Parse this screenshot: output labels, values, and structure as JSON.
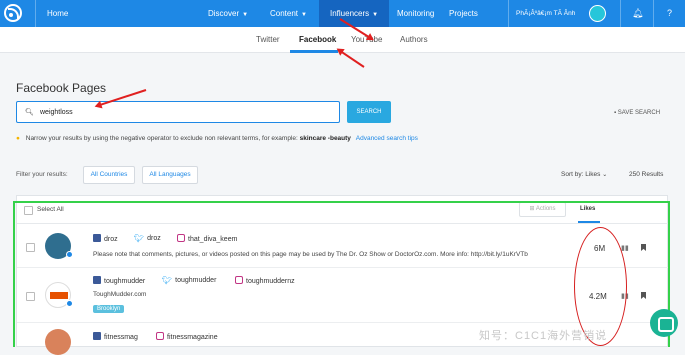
{
  "topbar": {
    "nav": [
      "Home",
      "Discover",
      "Content",
      "Influencers",
      "Monitoring",
      "Projects"
    ],
    "user": "PhÃ¡Âºâ€¡m TÃ Â­nh"
  },
  "subnav": {
    "tabs": [
      "Twitter",
      "Facebook",
      "YouTube",
      "Authors"
    ],
    "active": "Facebook"
  },
  "page": {
    "title": "Facebook Pages",
    "search_value": "weightloss",
    "search_button": "SEARCH",
    "save_search": "SAVE SEARCH",
    "hint_text": "Narrow your results by using the negative operator to exclude non relevant terms, for example:",
    "hint_example": "skincare -beauty",
    "hint_link": "Advanced search tips"
  },
  "filters": {
    "label": "Filter your results:",
    "countries": "All Countries",
    "languages": "All Languages",
    "sort": "Sort by: Likes",
    "results": "250 Results"
  },
  "table": {
    "select_all": "Select All",
    "actions": "Actions",
    "likes_header": "Likes",
    "rows": [
      {
        "facebook": "droz",
        "twitter": "droz",
        "instagram": "that_diva_keem",
        "description": "Please note that comments, pictures, or videos posted on this page may be used by The Dr. Oz Show or DoctorOz.com. More info: http://bit.ly/1uKrVTb",
        "likes": "6M"
      },
      {
        "facebook": "toughmudder",
        "twitter": "toughmudder",
        "instagram": "toughmuddernz",
        "description": "ToughMudder.com",
        "badge": "Brooklyn",
        "likes": "4.2M"
      },
      {
        "facebook": "fitnessmag",
        "instagram": "fitnessmagazine"
      }
    ]
  },
  "watermark": "知号：C1C1海外营销说"
}
